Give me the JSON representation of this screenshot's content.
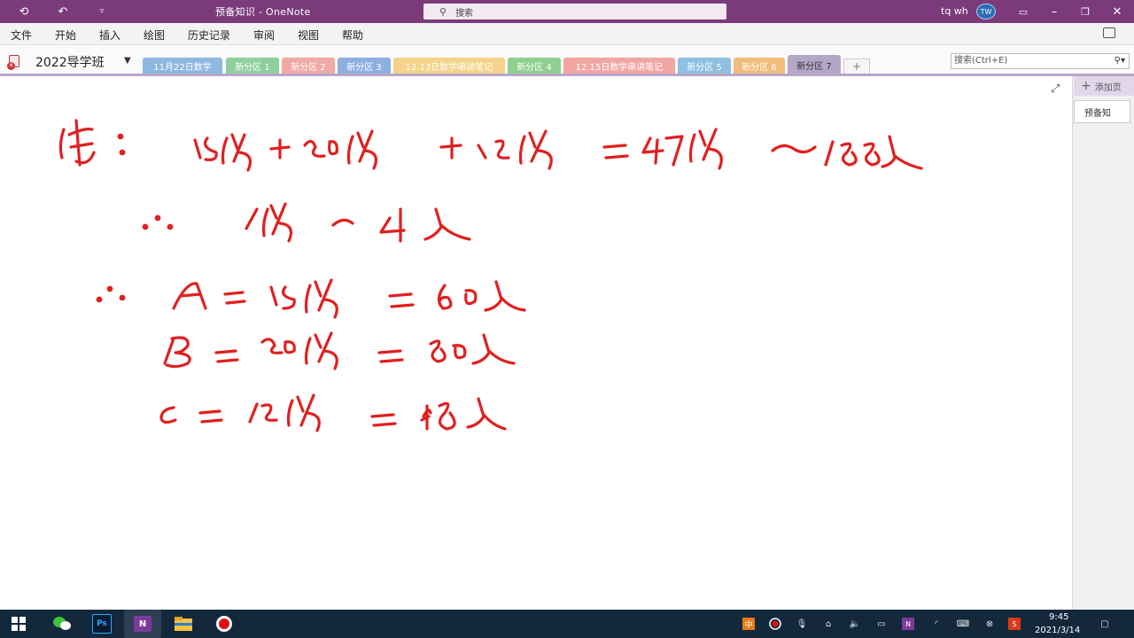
{
  "window": {
    "title": "预备知识 - OneNote",
    "search_placeholder": "搜索",
    "user_name": "tq wh",
    "user_initials": "TW"
  },
  "menu": {
    "items": [
      "文件",
      "开始",
      "插入",
      "绘图",
      "历史记录",
      "审阅",
      "视图",
      "帮助"
    ]
  },
  "notebook": {
    "name": "2022导学班",
    "search_placeholder": "搜索(Ctrl+E)",
    "sections": [
      {
        "label": "11月22日数学",
        "color": "#8eb8e0"
      },
      {
        "label": "新分区 1",
        "color": "#8ecf9c"
      },
      {
        "label": "新分区 2",
        "color": "#f0a9a3"
      },
      {
        "label": "新分区 3",
        "color": "#8eb0e0"
      },
      {
        "label": "12.13日数学串讲笔记",
        "color": "#f5d38a"
      },
      {
        "label": "新分区 4",
        "color": "#8fcf8f"
      },
      {
        "label": "12.15日数学串讲笔记",
        "color": "#f2a6a2"
      },
      {
        "label": "新分区 5",
        "color": "#8ec0e0"
      },
      {
        "label": "新分区 6",
        "color": "#f2bc7a"
      },
      {
        "label": "新分区 7",
        "color": "#b3a7c8"
      }
    ],
    "add_section": "+"
  },
  "pages": {
    "add_label": "添加页",
    "items": [
      "预备知"
    ]
  },
  "ink_color": "#e02020",
  "ink_text": [
    "解:  15份 + 20份 + 12份 = 47份 ~ 188人",
    "∴  1份 ~ 4人",
    "∴  A = 15份 = 60人",
    "B = 20份 = 80人",
    "C = 12份 = 48人"
  ],
  "taskbar": {
    "time": "9:45",
    "date": "2021/3/14"
  }
}
